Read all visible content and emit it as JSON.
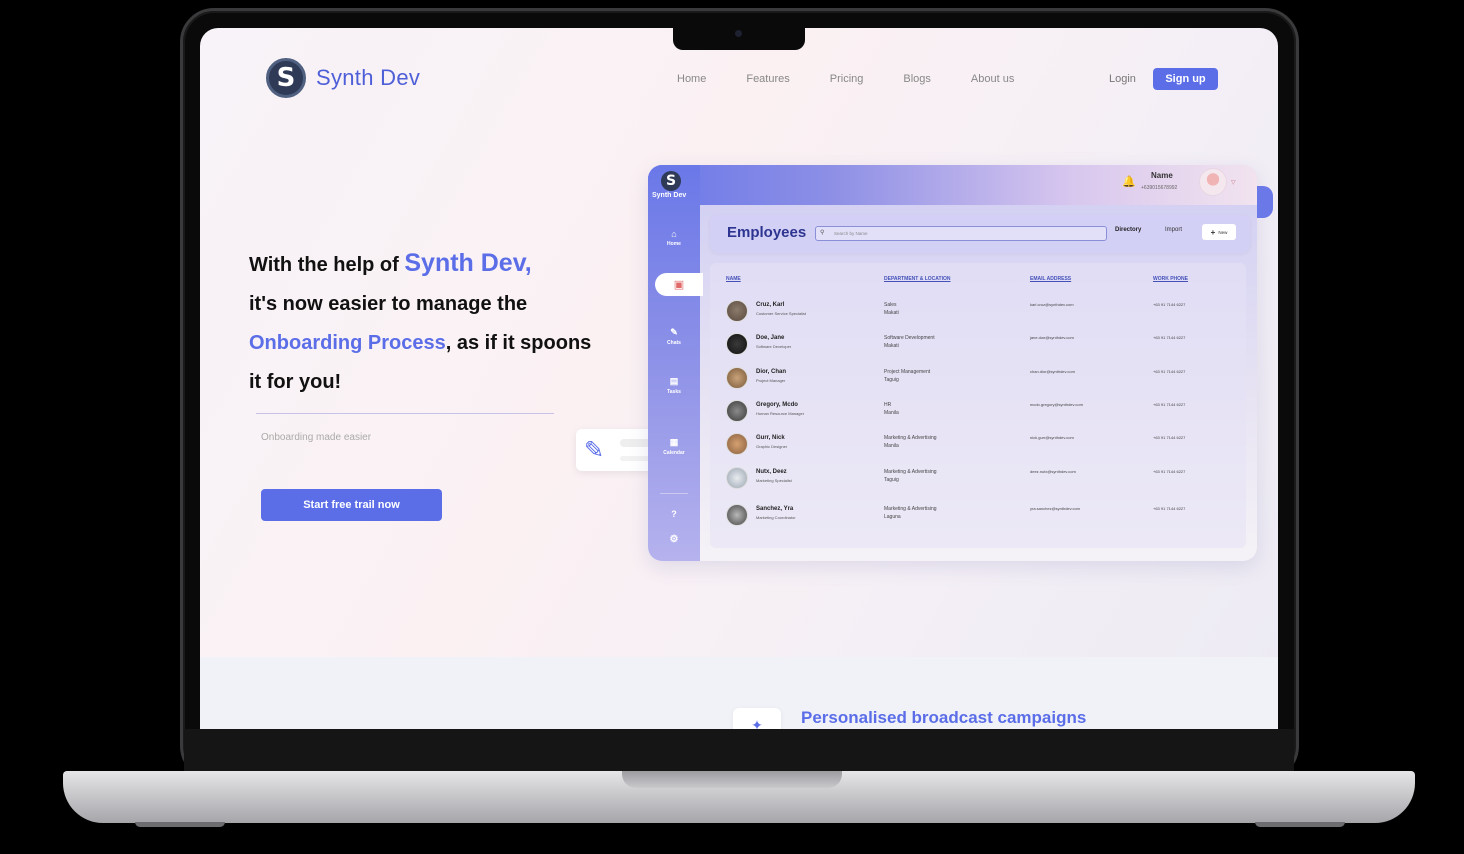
{
  "brand": {
    "name": "Synth Dev",
    "logo_letter": "S"
  },
  "nav": {
    "items": [
      "Home",
      "Features",
      "Pricing",
      "Blogs",
      "About us"
    ],
    "login": "Login",
    "signup": "Sign up"
  },
  "hero": {
    "line1_pre": "With the help of ",
    "line1_accent": "Synth Dev,",
    "line2": "it's now easier to manage the",
    "line3_accent": "Onboarding Process",
    "line3_post": ", as if it spoons",
    "line4": "it for you!",
    "tagline": "Onboarding made easier",
    "cta": "Start free trail now"
  },
  "dashboard": {
    "sidebar": {
      "logo_text": "Synth Dev",
      "items": [
        {
          "label": "Home",
          "icon": "home-icon",
          "glyph": "⌂"
        },
        {
          "label": "Chats",
          "icon": "chat-icon",
          "glyph": "✎"
        },
        {
          "label": "Tasks",
          "icon": "tasks-icon",
          "glyph": "▤"
        },
        {
          "label": "Calendar",
          "icon": "calendar-icon",
          "glyph": "▦"
        }
      ],
      "help_glyph": "?",
      "settings_glyph": "⚙"
    },
    "user": {
      "name": "Name",
      "phone": "+639015678992"
    },
    "title": "Employees",
    "search_placeholder": "Search by Name",
    "directory": "Directory",
    "import": "Import",
    "new": "New",
    "columns": [
      "NAME",
      "DEPARTMENT & LOCATION",
      "EMAIL ADDRESS",
      "WORK PHONE"
    ],
    "rows": [
      {
        "name": "Cruz, Karl",
        "role": "Customer Service Specialist",
        "dept": "Sales",
        "loc": "Makati",
        "email": "karl.cruz@synthdev.com",
        "phone": "+63 91 7144 6227"
      },
      {
        "name": "Doe, Jane",
        "role": "Software Developer",
        "dept": "Software Development",
        "loc": "Makati",
        "email": "jane.doe@synthdev.com",
        "phone": "+63 91 7144 6227"
      },
      {
        "name": "Dior, Chan",
        "role": "Project Manager",
        "dept": "Project Management",
        "loc": "Taguig",
        "email": "chan.dior@synthdev.com",
        "phone": "+63 91 7144 6227"
      },
      {
        "name": "Gregory, Mcdo",
        "role": "Human Resource Manager",
        "dept": "HR",
        "loc": "Manila",
        "email": "mcdo.gregory@synthdev.com",
        "phone": "+63 91 7144 6227"
      },
      {
        "name": "Gurr, Nick",
        "role": "Graphic Designer",
        "dept": "Marketing & Advertising",
        "loc": "Manila",
        "email": "nick.gurr@synthdev.com",
        "phone": "+63 91 7144 6227"
      },
      {
        "name": "Nutx, Deez",
        "role": "Marketing Specialist",
        "dept": "Marketing & Advertising",
        "loc": "Taguig",
        "email": "deez.nutx@synthdev.com",
        "phone": "+63 91 7144 6227"
      },
      {
        "name": "Sanchez, Yra",
        "role": "Marketing Coordinator",
        "dept": "Marketing & Advertising",
        "loc": "Laguna",
        "email": "yra.sanchez@synthdev.com",
        "phone": "+63 91 7144 6227"
      }
    ]
  },
  "features": {
    "first_title": "Personalised broadcast campaigns"
  },
  "colors": {
    "accent": "#5b6ee8",
    "heading": "#111111",
    "muted": "#888888"
  }
}
